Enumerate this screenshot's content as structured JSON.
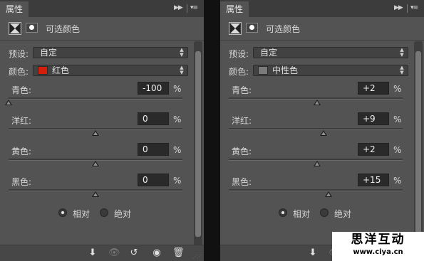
{
  "panels": [
    {
      "tab_title": "属性",
      "adjustment_title": "可选颜色",
      "preset": {
        "label": "预设:",
        "value": "自定"
      },
      "colors": {
        "label": "颜色:",
        "value": "红色",
        "swatch": "#d21e0a"
      },
      "sliders": [
        {
          "label": "青色:",
          "value": "-100",
          "unit": "%",
          "level": -100
        },
        {
          "label": "洋红:",
          "value": "0",
          "unit": "%",
          "level": 0
        },
        {
          "label": "黄色:",
          "value": "0",
          "unit": "%",
          "level": 0
        },
        {
          "label": "黑色:",
          "value": "0",
          "unit": "%",
          "level": 0
        }
      ],
      "method": {
        "relative_label": "相对",
        "absolute_label": "绝对",
        "selected": "relative"
      }
    },
    {
      "tab_title": "属性",
      "adjustment_title": "可选颜色",
      "preset": {
        "label": "预设:",
        "value": "自定"
      },
      "colors": {
        "label": "颜色:",
        "value": "中性色",
        "swatch": "#7a7a7a"
      },
      "sliders": [
        {
          "label": "青色:",
          "value": "+2",
          "unit": "%",
          "level": 2
        },
        {
          "label": "洋红:",
          "value": "+9",
          "unit": "%",
          "level": 9
        },
        {
          "label": "黄色:",
          "value": "+2",
          "unit": "%",
          "level": 2
        },
        {
          "label": "黑色:",
          "value": "+15",
          "unit": "%",
          "level": 15
        }
      ],
      "method": {
        "relative_label": "相对",
        "absolute_label": "绝对",
        "selected": "relative"
      }
    }
  ],
  "watermark": {
    "title": "思洋互动",
    "url": "www.ciya.cn"
  }
}
